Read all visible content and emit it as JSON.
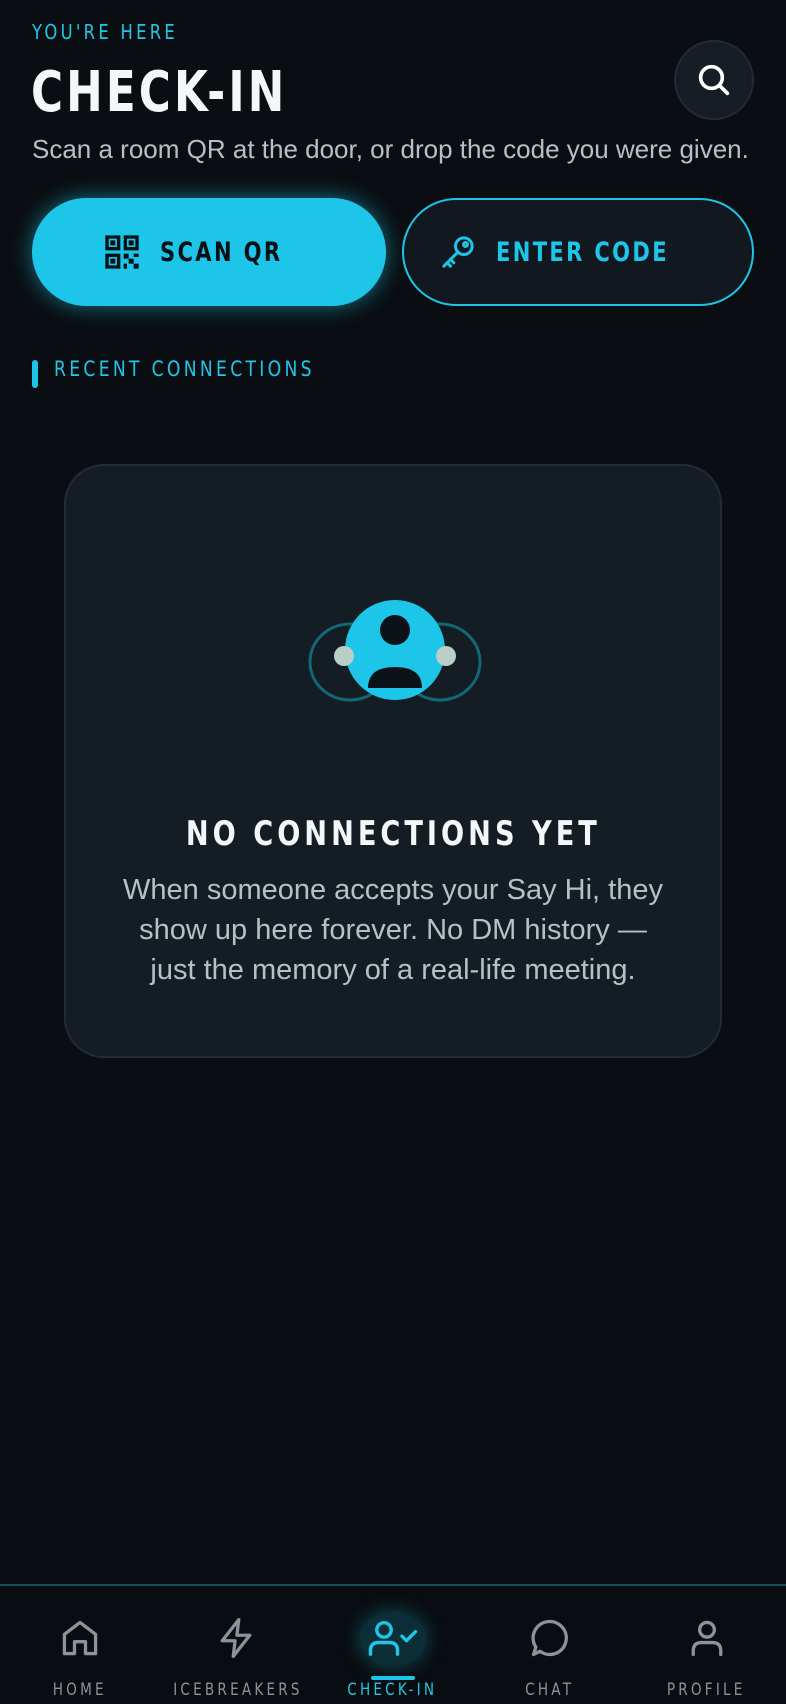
{
  "header": {
    "eyebrow": "YOU'RE HERE",
    "title": "CHECK-IN",
    "subtitle": "Scan a room QR at the door, or drop the code you were given.",
    "search_icon": "search-icon"
  },
  "actions": {
    "scan_label": "SCAN QR",
    "scan_icon": "qr-code-icon",
    "code_label": "ENTER CODE",
    "code_icon": "key-icon"
  },
  "section": {
    "label": "RECENT CONNECTIONS"
  },
  "empty_state": {
    "icon": "connections-icon",
    "title": "NO CONNECTIONS YET",
    "body": "When someone accepts your Say Hi, they show up here forever. No DM history — just the memory of a real-life meeting."
  },
  "nav": {
    "items": [
      {
        "label": "HOME",
        "icon": "home-icon"
      },
      {
        "label": "ICEBREAKERS",
        "icon": "lightning-icon"
      },
      {
        "label": "CHECK-IN",
        "icon": "user-check-icon",
        "active": true
      },
      {
        "label": "CHAT",
        "icon": "chat-bubble-icon"
      },
      {
        "label": "PROFILE",
        "icon": "user-icon"
      }
    ]
  },
  "colors": {
    "background": "#0a0e12",
    "accent": "#1dc6e8",
    "card": "#141c24",
    "muted_text": "#b7c1c4"
  }
}
